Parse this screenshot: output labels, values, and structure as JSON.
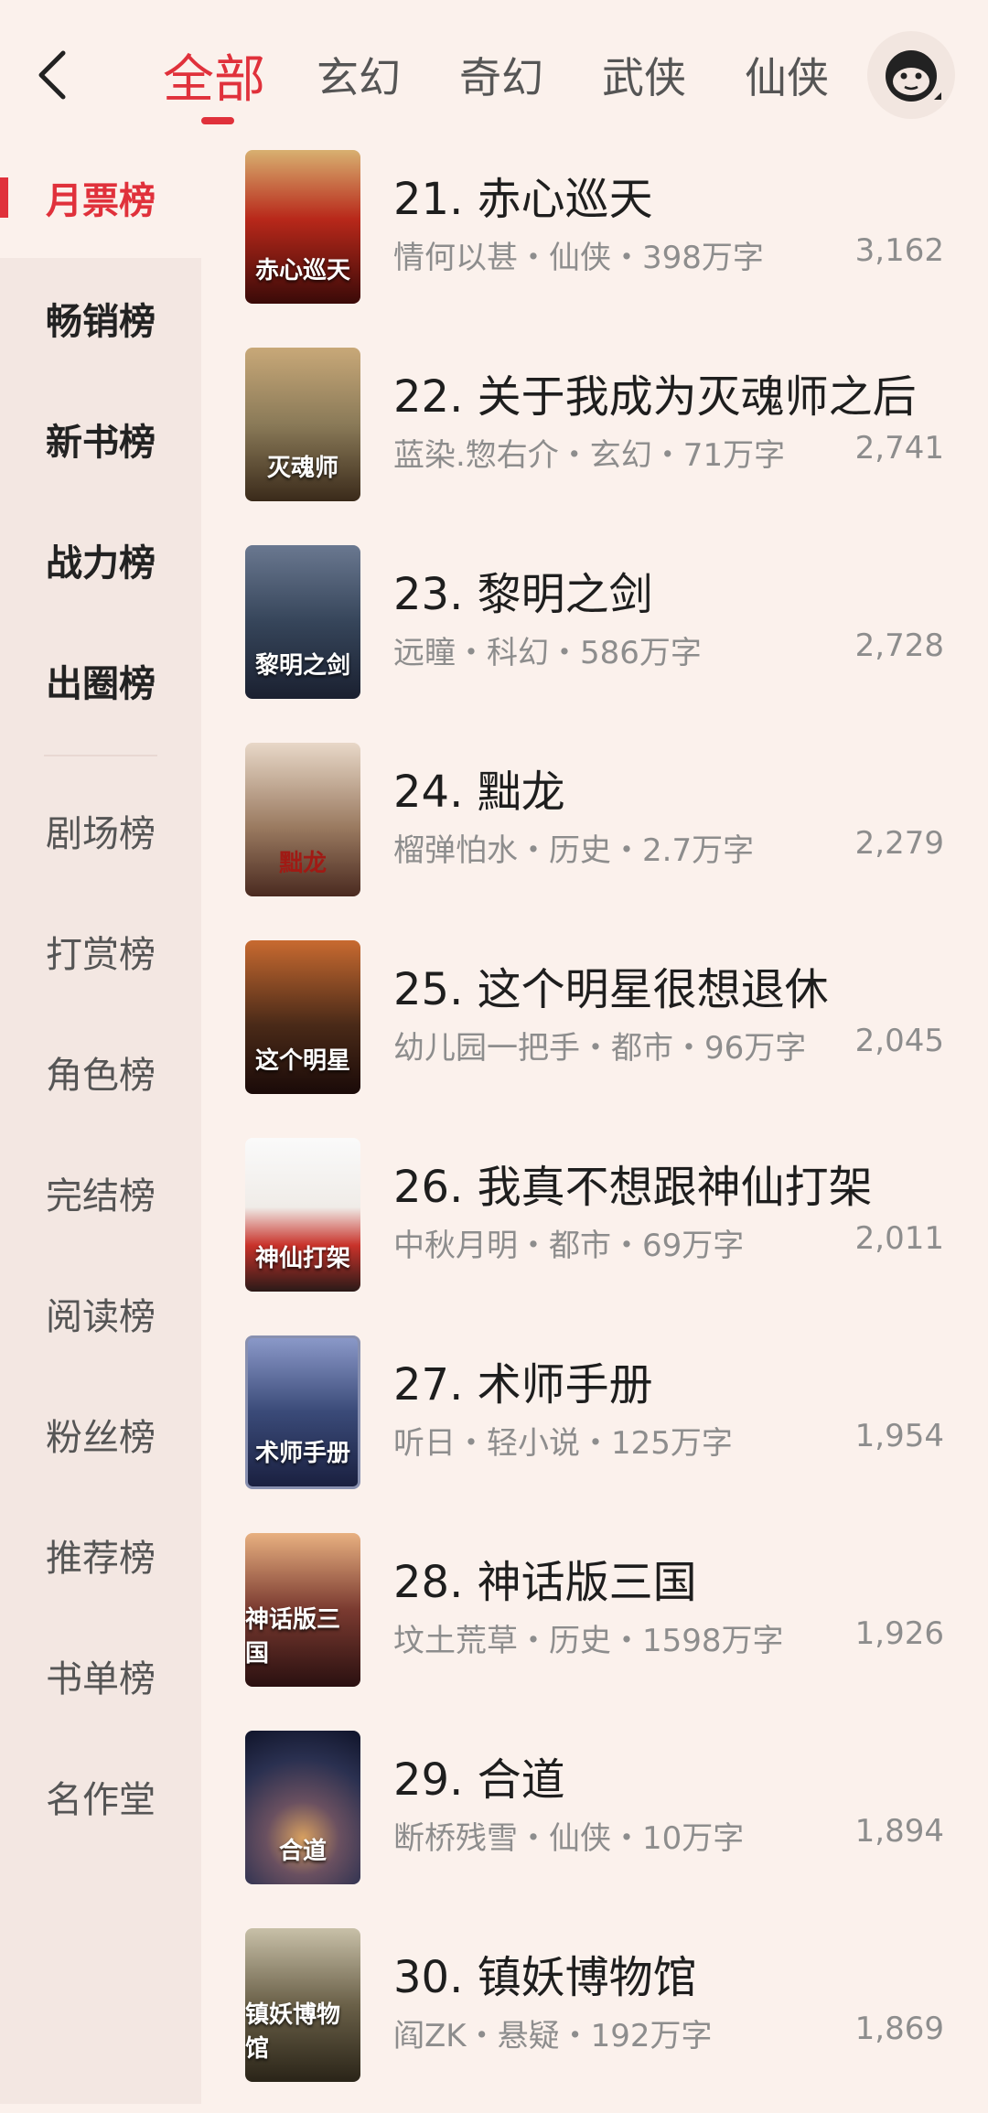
{
  "header": {
    "tabs": [
      "全部",
      "玄幻",
      "奇幻",
      "武侠",
      "仙侠"
    ],
    "active_tab": "全部"
  },
  "sidebar": {
    "items": [
      "月票榜",
      "畅销榜",
      "新书榜",
      "战力榜",
      "出圈榜",
      "剧场榜",
      "打赏榜",
      "角色榜",
      "完结榜",
      "阅读榜",
      "粉丝榜",
      "推荐榜",
      "书单榜",
      "名作堂"
    ],
    "active": "月票榜"
  },
  "books": [
    {
      "title": "21. 赤心巡天",
      "meta": "情何以甚・仙侠・398万字",
      "votes": "3,162",
      "cover_text": "赤心巡天",
      "cover_color": "#7a1a12"
    },
    {
      "title": "22. 关于我成为灭魂师之后",
      "meta": "蓝染.惣右介・玄幻・71万字",
      "votes": "2,741",
      "cover_text": "灭魂师",
      "cover_color": "#8a7a58"
    },
    {
      "title": "23. 黎明之剑",
      "meta": "远瞳・科幻・586万字",
      "votes": "2,728",
      "cover_text": "黎明之剑",
      "cover_color": "#36455a"
    },
    {
      "title": "24. 黜龙",
      "meta": "榴弹怕水・历史・2.7万字",
      "votes": "2,279",
      "cover_text": "黜龙",
      "cover_color": "#9a7a60"
    },
    {
      "title": "25. 这个明星很想退休",
      "meta": "幼儿园一把手・都市・96万字",
      "votes": "2,045",
      "cover_text": "这个明星",
      "cover_color": "#4a2a18"
    },
    {
      "title": "26. 我真不想跟神仙打架",
      "meta": "中秋月明・都市・69万字",
      "votes": "2,011",
      "cover_text": "神仙打架",
      "cover_color": "#c8322a"
    },
    {
      "title": "27. 术师手册",
      "meta": "听日・轻小说・125万字",
      "votes": "1,954",
      "cover_text": "术师手册",
      "cover_color": "#3a4a78"
    },
    {
      "title": "28. 神话版三国",
      "meta": "坟土荒草・历史・1598万字",
      "votes": "1,926",
      "cover_text": "神话版三国",
      "cover_color": "#7a3a30"
    },
    {
      "title": "29. 合道",
      "meta": "断桥残雪・仙侠・10万字",
      "votes": "1,894",
      "cover_text": "合道",
      "cover_color": "#2a3050"
    },
    {
      "title": "30. 镇妖博物馆",
      "meta": "阎ZK・悬疑・192万字",
      "votes": "1,869",
      "cover_text": "镇妖博物馆",
      "cover_color": "#4a4030"
    }
  ],
  "colors": {
    "accent": "#e0313b",
    "background": "#fbf1ec",
    "sidebar": "#f3e7e2"
  }
}
